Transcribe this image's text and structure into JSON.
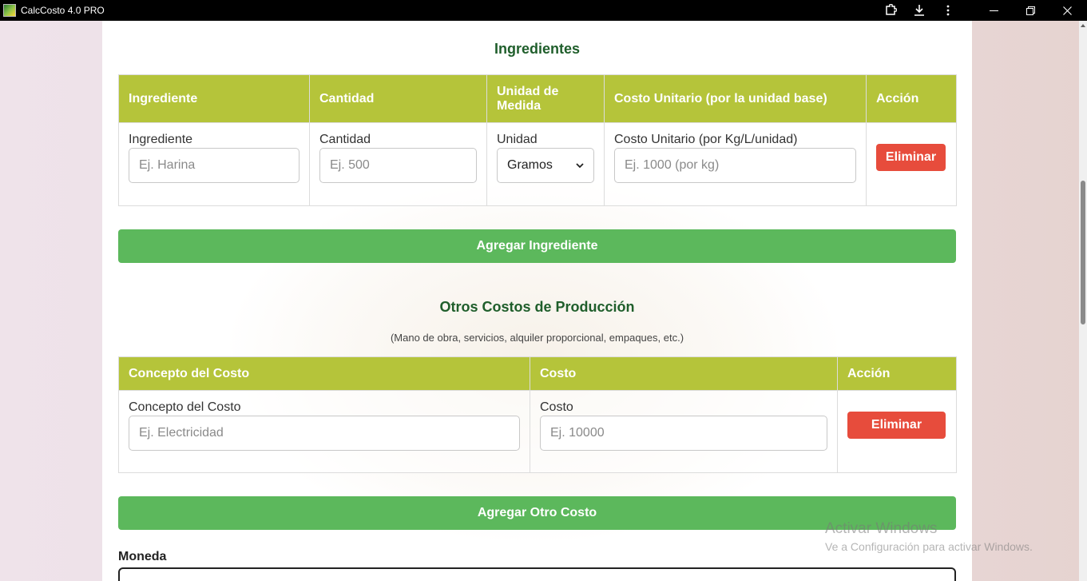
{
  "window": {
    "title": "CalcCosto 4.0 PRO",
    "icons": [
      "extension-icon",
      "download-icon",
      "more-vertical-icon"
    ],
    "controls": [
      "minimize-icon",
      "restore-icon",
      "close-icon"
    ]
  },
  "ingredients": {
    "title": "Ingredientes",
    "headers": [
      "Ingrediente",
      "Cantidad",
      "Unidad de Medida",
      "Costo Unitario (por la unidad base)",
      "Acción"
    ],
    "row": {
      "ingredient_label": "Ingrediente",
      "ingredient_placeholder": "Ej. Harina",
      "quantity_label": "Cantidad",
      "quantity_placeholder": "Ej. 500",
      "unit_label": "Unidad",
      "unit_selected": "Gramos",
      "cost_label": "Costo Unitario (por Kg/L/unidad)",
      "cost_placeholder": "Ej. 1000 (por kg)",
      "delete_label": "Eliminar"
    },
    "add_label": "Agregar Ingrediente"
  },
  "other_costs": {
    "title": "Otros Costos de Producción",
    "subtitle": "(Mano de obra, servicios, alquiler proporcional, empaques, etc.)",
    "headers": [
      "Concepto del Costo",
      "Costo",
      "Acción"
    ],
    "row": {
      "concept_label": "Concepto del Costo",
      "concept_placeholder": "Ej. Electricidad",
      "cost_label": "Costo",
      "cost_placeholder": "Ej. 10000",
      "delete_label": "Eliminar"
    },
    "add_label": "Agregar Otro Costo"
  },
  "currency": {
    "label": "Moneda"
  },
  "watermark": {
    "line1": "Activar Windows",
    "line2": "Ve a Configuración para activar Windows."
  },
  "colors": {
    "header_bg": "#b5c43a",
    "title_green": "#1f5e2b",
    "add_button": "#5cb85c",
    "delete_button": "#e74c3c"
  }
}
